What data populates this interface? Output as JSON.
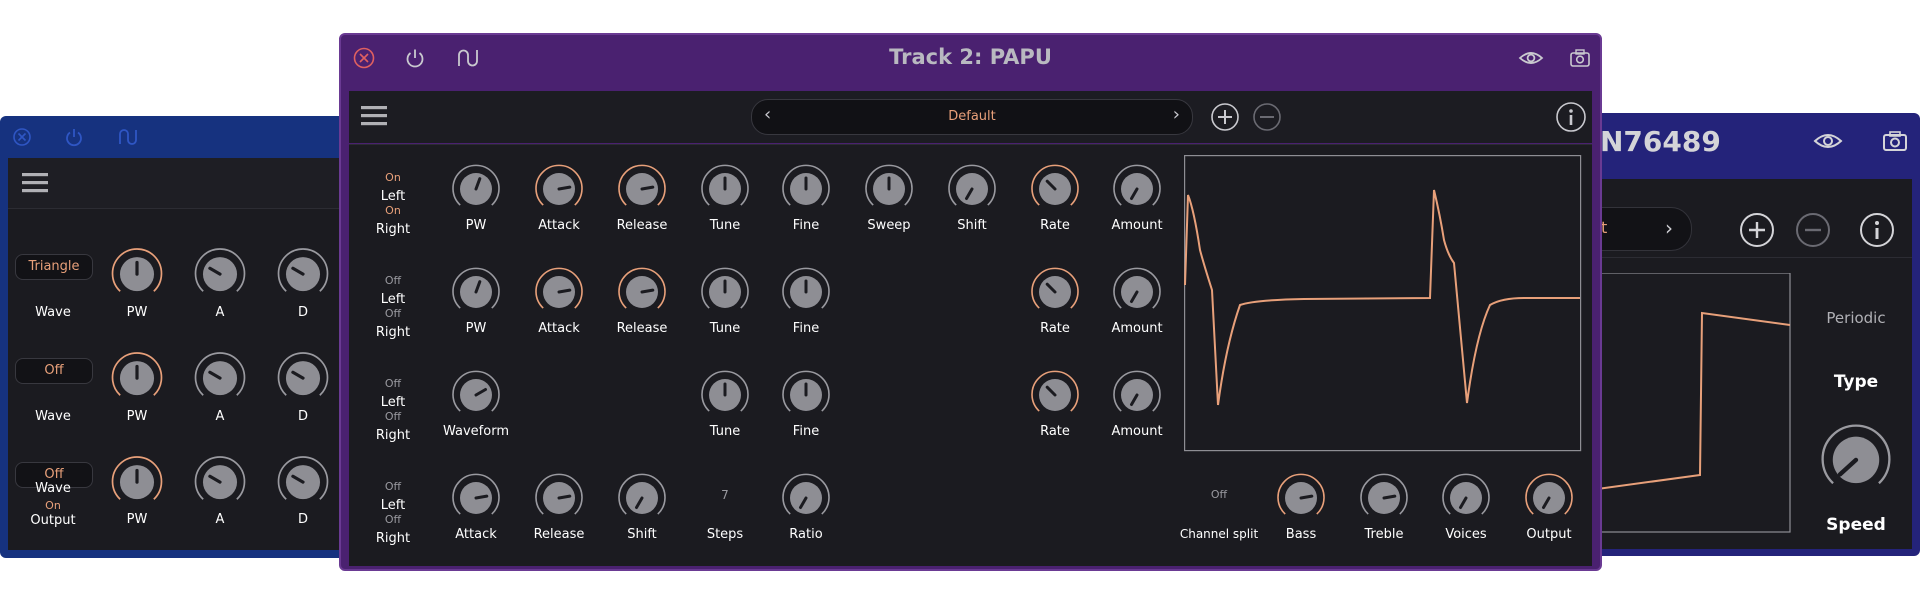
{
  "colors": {
    "accent": "#e8a07a",
    "panel": "#1b1b20",
    "main_title_bar": "#4a2170",
    "left_title_bar": "#16327f",
    "right_title_bar": "#24237a",
    "knob": "#8e8e94"
  },
  "main": {
    "title": "Track 2: PAPU",
    "preset": "Default",
    "rows": [
      {
        "toggles": [
          "On",
          "Left",
          "On",
          "Right"
        ],
        "knobs": [
          {
            "label": "PW",
            "accent": false,
            "angle": 20
          },
          {
            "label": "Attack",
            "accent": true,
            "angle": 80
          },
          {
            "label": "Release",
            "accent": true,
            "angle": 80
          },
          {
            "label": "Tune",
            "accent": false,
            "angle": 0
          },
          {
            "label": "Fine",
            "accent": false,
            "angle": 0
          },
          {
            "label": "Sweep",
            "accent": false,
            "angle": 0
          },
          {
            "label": "Shift",
            "accent": false,
            "angle": -150
          },
          {
            "label": "Rate",
            "accent": true,
            "angle": -45
          },
          {
            "label": "Amount",
            "accent": false,
            "angle": -150
          }
        ]
      },
      {
        "toggles": [
          "Off",
          "Left",
          "Off",
          "Right"
        ],
        "knobs": [
          {
            "label": "PW",
            "accent": false,
            "angle": 20
          },
          {
            "label": "Attack",
            "accent": true,
            "angle": 80
          },
          {
            "label": "Release",
            "accent": true,
            "angle": 80
          },
          {
            "label": "Tune",
            "accent": false,
            "angle": 0
          },
          {
            "label": "Fine",
            "accent": false,
            "angle": 0
          },
          {
            "label": "Rate",
            "accent": true,
            "angle": -45
          },
          {
            "label": "Amount",
            "accent": false,
            "angle": -150
          }
        ]
      },
      {
        "toggles": [
          "Off",
          "Left",
          "Off",
          "Right"
        ],
        "knobs": [
          {
            "label": "Waveform",
            "accent": false,
            "angle": 60
          },
          {
            "label": "Tune",
            "accent": false,
            "angle": 0
          },
          {
            "label": "Fine",
            "accent": false,
            "angle": 0
          },
          {
            "label": "Rate",
            "accent": true,
            "angle": -45
          },
          {
            "label": "Amount",
            "accent": false,
            "angle": -150
          }
        ]
      },
      {
        "toggles": [
          "Off",
          "Left",
          "Off",
          "Right"
        ],
        "knobs": [
          {
            "label": "Attack",
            "accent": false,
            "angle": 80
          },
          {
            "label": "Release",
            "accent": false,
            "angle": 80
          },
          {
            "label": "Shift",
            "accent": false,
            "angle": -150
          },
          {
            "label": "Ratio",
            "accent": false,
            "angle": -150
          }
        ],
        "steps_value": "7",
        "steps_label": "Steps"
      }
    ],
    "bottom": {
      "channel_split_value": "Off",
      "channel_split_label": "Channel split",
      "knobs": [
        {
          "label": "Bass",
          "accent": true,
          "angle": 80
        },
        {
          "label": "Treble",
          "accent": false,
          "angle": 80
        },
        {
          "label": "Voices",
          "accent": false,
          "angle": -150
        },
        {
          "label": "Output",
          "accent": true,
          "angle": -150
        }
      ]
    }
  },
  "left": {
    "rows": [
      {
        "wave_value": "Triangle",
        "wave_label": "Wave",
        "knobs": [
          "PW",
          "A",
          "D"
        ]
      },
      {
        "wave_value": "Off",
        "wave_label": "Wave",
        "knobs": [
          "PW",
          "A",
          "D"
        ]
      },
      {
        "wave_value": "Off",
        "wave_label": "Wave",
        "extra_value": "On",
        "extra_label": "Output",
        "knobs": [
          "PW",
          "A",
          "D"
        ]
      }
    ]
  },
  "right": {
    "title_fragment": "N76489",
    "preset_fragment": "t",
    "periodic_label": "Periodic",
    "type_label": "Type",
    "speed_label": "Speed"
  }
}
